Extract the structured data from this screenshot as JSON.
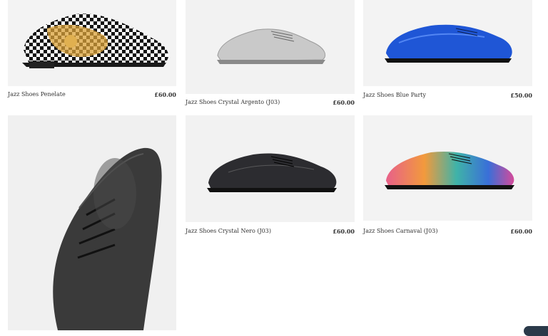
{
  "products": [
    {
      "name": "Jazz Shoes Penelate",
      "price": "£60.00",
      "image_icon": "patterned-jazz-shoe"
    },
    {
      "name": "Jazz Shoes Crystal Argento (J03)",
      "price": "£60.00",
      "image_icon": "silver-glitter-jazz-shoe"
    },
    {
      "name": "Jazz Shoes Blue Party",
      "price": "£50.00",
      "image_icon": "blue-metallic-jazz-shoe"
    },
    {
      "name": "",
      "price": "",
      "image_icon": "black-leather-jazz-shoe"
    },
    {
      "name": "Jazz Shoes Crystal Nero (J03)",
      "price": "£60.00",
      "image_icon": "black-glitter-jazz-shoe"
    },
    {
      "name": "Jazz Shoes Carnaval (J03)",
      "price": "£60.00",
      "image_icon": "rainbow-jazz-shoe"
    }
  ],
  "colors": {
    "accent_dark": "#2b3a4a",
    "background": "#ffffff"
  }
}
